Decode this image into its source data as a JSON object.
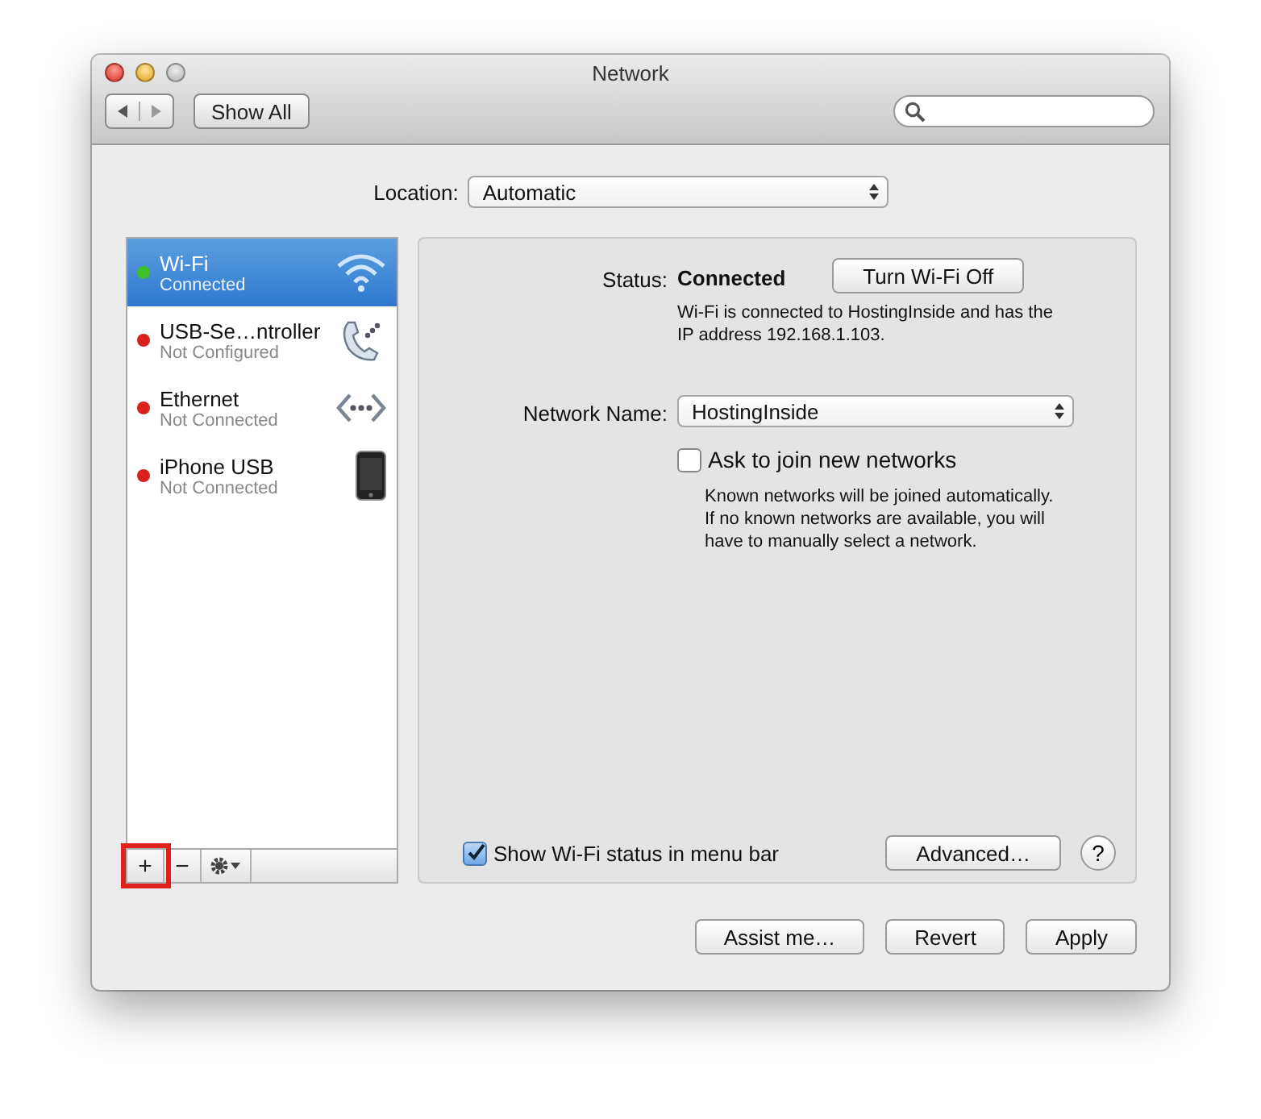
{
  "window": {
    "title": "Network"
  },
  "toolbar": {
    "show_all": "Show All"
  },
  "location": {
    "label": "Location:",
    "value": "Automatic"
  },
  "services": [
    {
      "name": "Wi-Fi",
      "status": "Connected",
      "color": "#3fbf2a",
      "kind": "wifi",
      "selected": true
    },
    {
      "name": "USB-Se…ntroller",
      "status": "Not Configured",
      "color": "#d9201c",
      "kind": "phone",
      "selected": false
    },
    {
      "name": "Ethernet",
      "status": "Not Connected",
      "color": "#d9201c",
      "kind": "ethernet",
      "selected": false
    },
    {
      "name": "iPhone USB",
      "status": "Not Connected",
      "color": "#d9201c",
      "kind": "iphone",
      "selected": false
    }
  ],
  "list_buttons": [
    {
      "label": "+",
      "kind": "add",
      "highlighted": true
    },
    {
      "label": "−",
      "kind": "remove",
      "highlighted": false
    },
    {
      "kind": "gear",
      "highlighted": false
    }
  ],
  "detail": {
    "status_label": "Status:",
    "status": "Connected",
    "toggle_button": "Turn Wi-Fi Off",
    "status_text": "Wi-Fi is connected to HostingInside and has the IP address 192.168.1.103.",
    "network_label": "Network Name:",
    "network": "HostingInside",
    "ask": {
      "label": "Ask to join new networks",
      "checked": false
    },
    "ask_text": "Known networks will be joined automatically. If no known networks are available, you will have to manually select a network.",
    "show_status": {
      "label": "Show Wi-Fi status in menu bar",
      "checked": true
    },
    "advanced_button": "Advanced…",
    "help_button": "?"
  },
  "footer_buttons": [
    "Assist me…",
    "Revert",
    "Apply"
  ]
}
